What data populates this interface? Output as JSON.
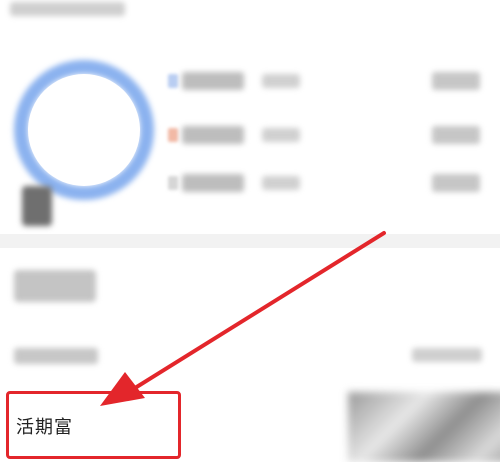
{
  "annotation": {
    "highlight_color": "#e3262b",
    "arrow_color": "#e3262b"
  },
  "chart": {
    "ring_color": "#8bb2ef",
    "legend": [
      {
        "dot_color": "#b9cdf2"
      },
      {
        "dot_color": "#f2b9a6"
      },
      {
        "dot_color": "#d6d6d6"
      }
    ]
  },
  "product": {
    "name": "活期富"
  }
}
